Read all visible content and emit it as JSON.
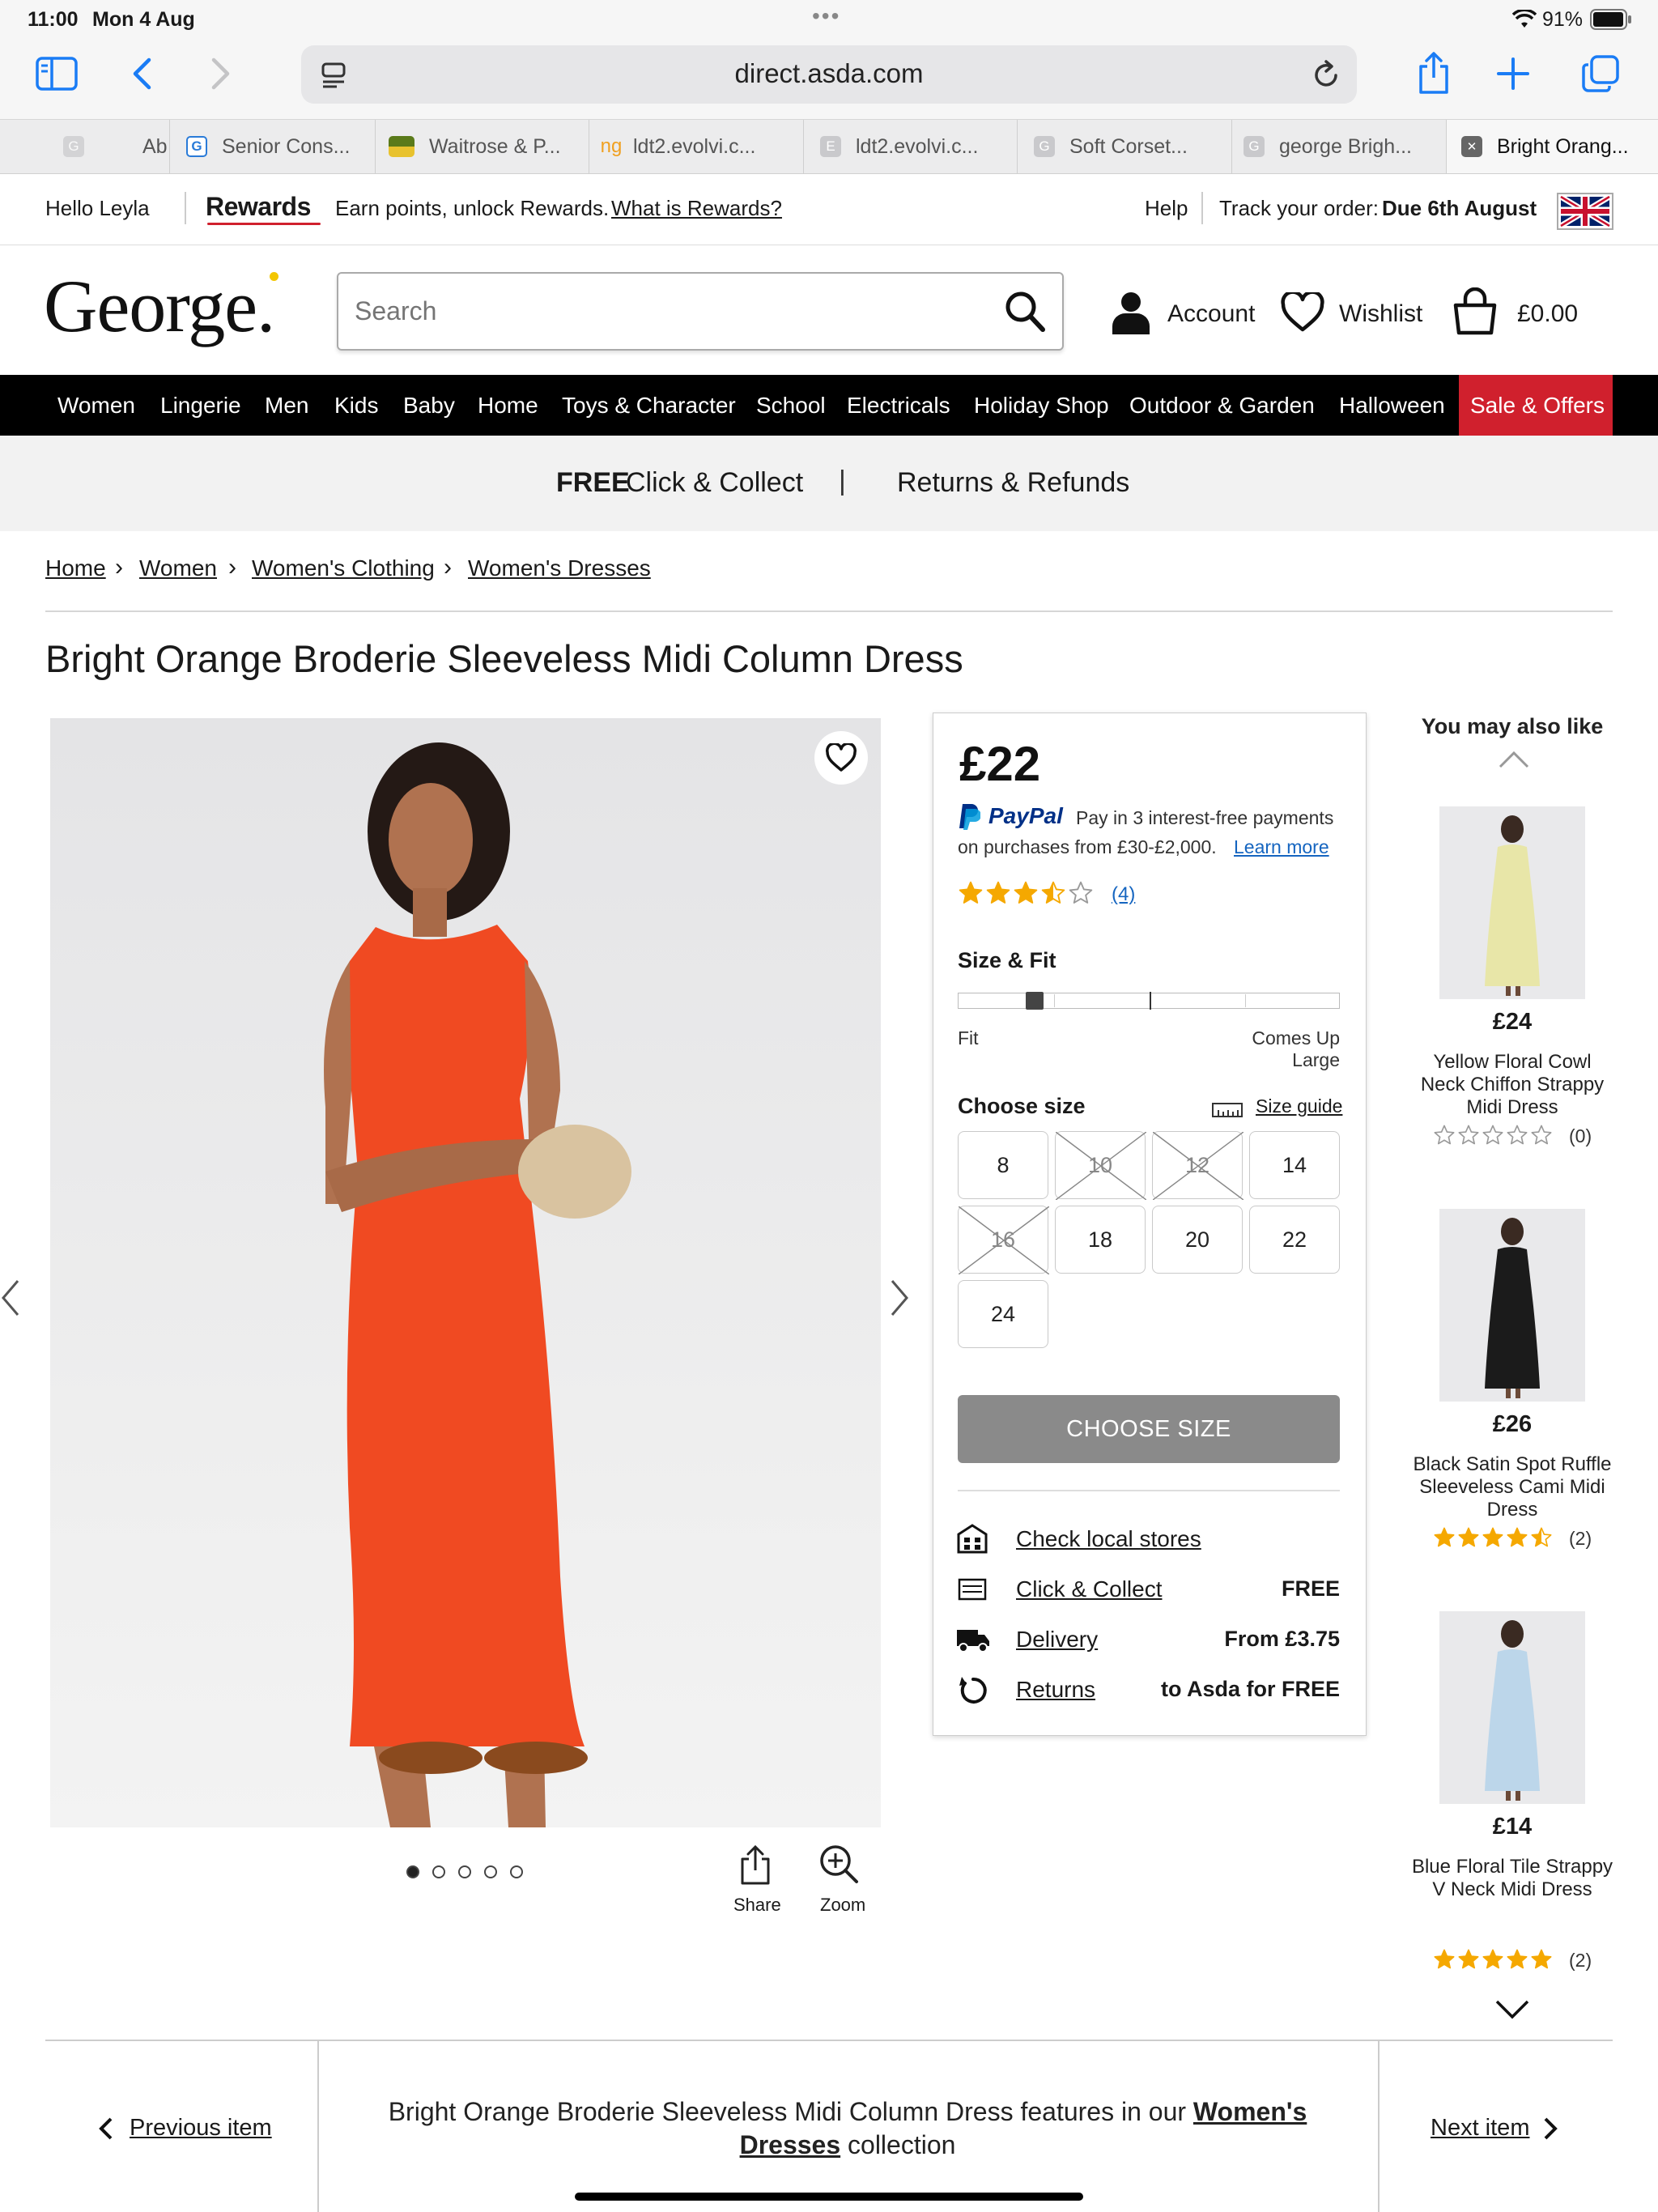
{
  "status": {
    "time": "11:00",
    "date": "Mon 4 Aug",
    "battery": "91%"
  },
  "browser": {
    "url": "direct.asda.com",
    "tabs": [
      {
        "label": "Ab",
        "favicon": "G"
      },
      {
        "label": "Senior Cons...",
        "favicon": "G"
      },
      {
        "label": "Waitrose & P...",
        "favicon": ""
      },
      {
        "label": "ldt2.evolvi.c...",
        "favicon": "ng"
      },
      {
        "label": "ldt2.evolvi.c...",
        "favicon": "E"
      },
      {
        "label": "Soft Corset...",
        "favicon": "G"
      },
      {
        "label": "george Brigh...",
        "favicon": "G"
      },
      {
        "label": "Bright Orang...",
        "favicon": "✕"
      }
    ]
  },
  "topstrip": {
    "greeting": "Hello Leyla",
    "rewards_brand": "Rewards",
    "rewards_text": "Earn points, unlock Rewards.",
    "rewards_link": "What is Rewards?",
    "help": "Help",
    "track_label": "Track your order:",
    "track_value": "Due 6th August"
  },
  "header": {
    "logo": "George.",
    "search_placeholder": "Search",
    "account": "Account",
    "wishlist": "Wishlist",
    "basket": "£0.00"
  },
  "nav": [
    "Women",
    "Lingerie",
    "Men",
    "Kids",
    "Baby",
    "Home",
    "Toys & Character",
    "School",
    "Electricals",
    "Holiday Shop",
    "Outdoor & Garden",
    "Halloween",
    "Sale & Offers"
  ],
  "promo": {
    "free": "FREE",
    "click_collect": "Click & Collect",
    "divider": "|",
    "returns": "Returns & Refunds"
  },
  "breadcrumb": [
    "Home",
    "Women",
    "Women's Clothing",
    "Women's Dresses"
  ],
  "product": {
    "title": "Bright Orange Broderie Sleeveless Midi Column Dress",
    "price": "£22",
    "paypal_brand": "PayPal",
    "paypal_line1": "Pay in 3 interest-free payments",
    "paypal_line2": "on purchases from £30-£2,000.",
    "paypal_link": "Learn more",
    "rating": 3.5,
    "rating_count": "(4)",
    "fit_title": "Size & Fit",
    "fit_left": "Fit",
    "fit_right": "Comes Up Large",
    "fit_level": 0.2,
    "choose_size": "Choose size",
    "size_guide": "Size guide",
    "sizes": [
      {
        "label": "8",
        "available": true
      },
      {
        "label": "10",
        "available": false
      },
      {
        "label": "12",
        "available": false
      },
      {
        "label": "14",
        "available": true
      },
      {
        "label": "16",
        "available": false
      },
      {
        "label": "18",
        "available": true
      },
      {
        "label": "20",
        "available": true
      },
      {
        "label": "22",
        "available": true
      },
      {
        "label": "24",
        "available": true
      }
    ],
    "cta": "CHOOSE SIZE",
    "services": [
      {
        "label": "Check local stores",
        "value": "",
        "icon": "store-icon"
      },
      {
        "label": "Click & Collect",
        "value": "FREE",
        "icon": "click-collect-icon"
      },
      {
        "label": "Delivery",
        "value": "From £3.75",
        "icon": "truck-icon"
      },
      {
        "label": "Returns",
        "value": "to Asda for FREE",
        "icon": "returns-icon"
      }
    ],
    "share": "Share",
    "zoom": "Zoom",
    "image_count": 5,
    "image_index": 1
  },
  "recommendations": {
    "title": "You may also like",
    "items": [
      {
        "price": "£24",
        "name": "Yellow Floral Cowl Neck Chiffon Strappy Midi Dress",
        "rating": 0,
        "count": "(0)",
        "color": "#e8e6a8"
      },
      {
        "price": "£26",
        "name": "Black Satin Spot Ruffle Sleeveless Cami Midi Dress",
        "rating": 4.5,
        "count": "(2)",
        "color": "#1b1b1b"
      },
      {
        "price": "£14",
        "name": "Blue Floral Tile Strappy V Neck Midi Dress",
        "rating": 5,
        "count": "(2)",
        "color": "#bcd6ea"
      }
    ]
  },
  "footer_nav": {
    "previous": "Previous item",
    "next": "Next item",
    "text_before": "Bright Orange Broderie Sleeveless Midi Column Dress features in our",
    "collection_link": "Women's Dresses",
    "text_after": "collection"
  },
  "colors": {
    "accent_red": "#d0202d",
    "paypal_blue": "#003087",
    "paypal_light": "#009cde",
    "star": "#f5a800",
    "link_blue": "#1565c0",
    "ios_blue": "#1a7cf5",
    "dress": "#f04a22"
  }
}
